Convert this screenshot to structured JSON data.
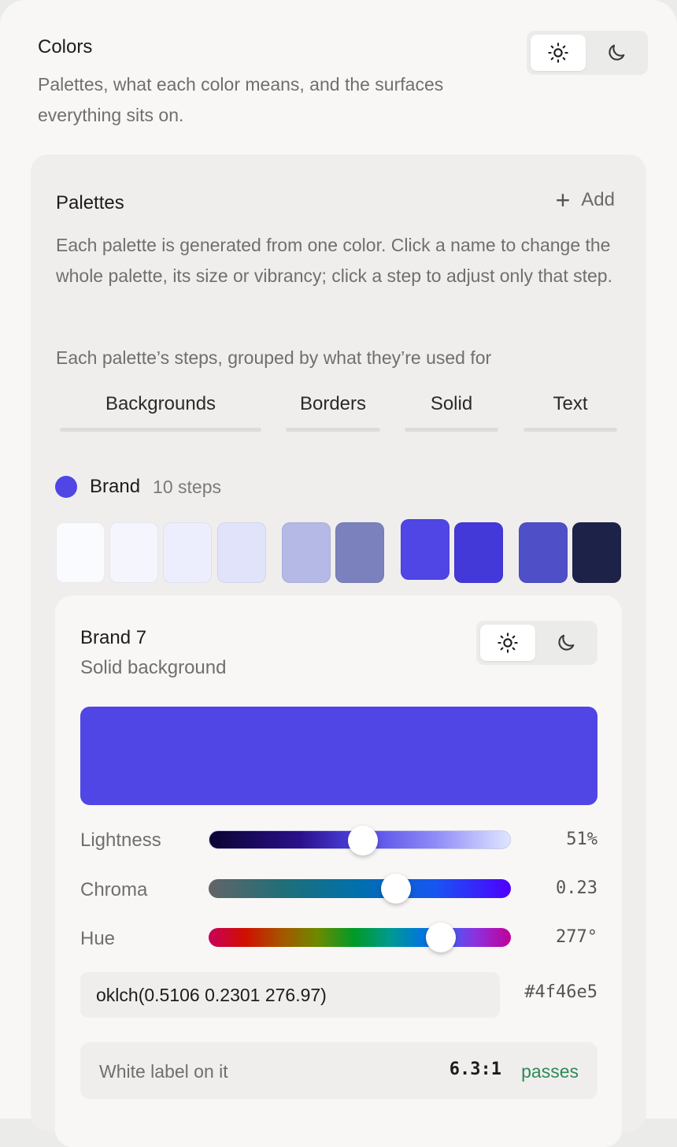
{
  "header": {
    "title": "Colors",
    "subtitle": "Palettes, what each color means, and the surfaces everything sits on."
  },
  "theme_toggle": {
    "light_icon": "sun-icon",
    "dark_icon": "moon-icon",
    "selected": "light"
  },
  "palettes": {
    "title": "Palettes",
    "add_label": "Add",
    "description": "Each palette is generated from one color. Click a name to change the whole palette, its size or vibrancy; click a step to adjust only that step.",
    "groups_caption": "Each palette’s steps, grouped by what they’re used for",
    "groups": [
      "Backgrounds",
      "Borders",
      "Solid",
      "Text"
    ]
  },
  "brand": {
    "name": "Brand",
    "steps_label": "10 steps",
    "color": "#4f46e5",
    "swatches": [
      "#fafbfe",
      "#f4f5fd",
      "#eceefd",
      "#e0e3f9",
      "#b4b9e6",
      "#7b81bd",
      "#4f46e5",
      "#4338d8",
      "#4f4fc8",
      "#1d2249"
    ],
    "selected_step": 7
  },
  "step_editor": {
    "title": "Brand 7",
    "subtitle": "Solid background",
    "preview_color": "#4f46e5",
    "sliders": [
      {
        "label": "Lightness",
        "value_text": "51%",
        "fraction": 0.51
      },
      {
        "label": "Chroma",
        "value_text": "0.23",
        "fraction": 0.62
      },
      {
        "label": "Hue",
        "value_text": "277°",
        "fraction": 0.769
      }
    ],
    "oklch_value": "oklch(0.5106 0.2301 276.97)",
    "hex": "#4f46e5",
    "contrast": {
      "label": "White label on it",
      "ratio": "6.3:1",
      "status": "passes"
    }
  }
}
